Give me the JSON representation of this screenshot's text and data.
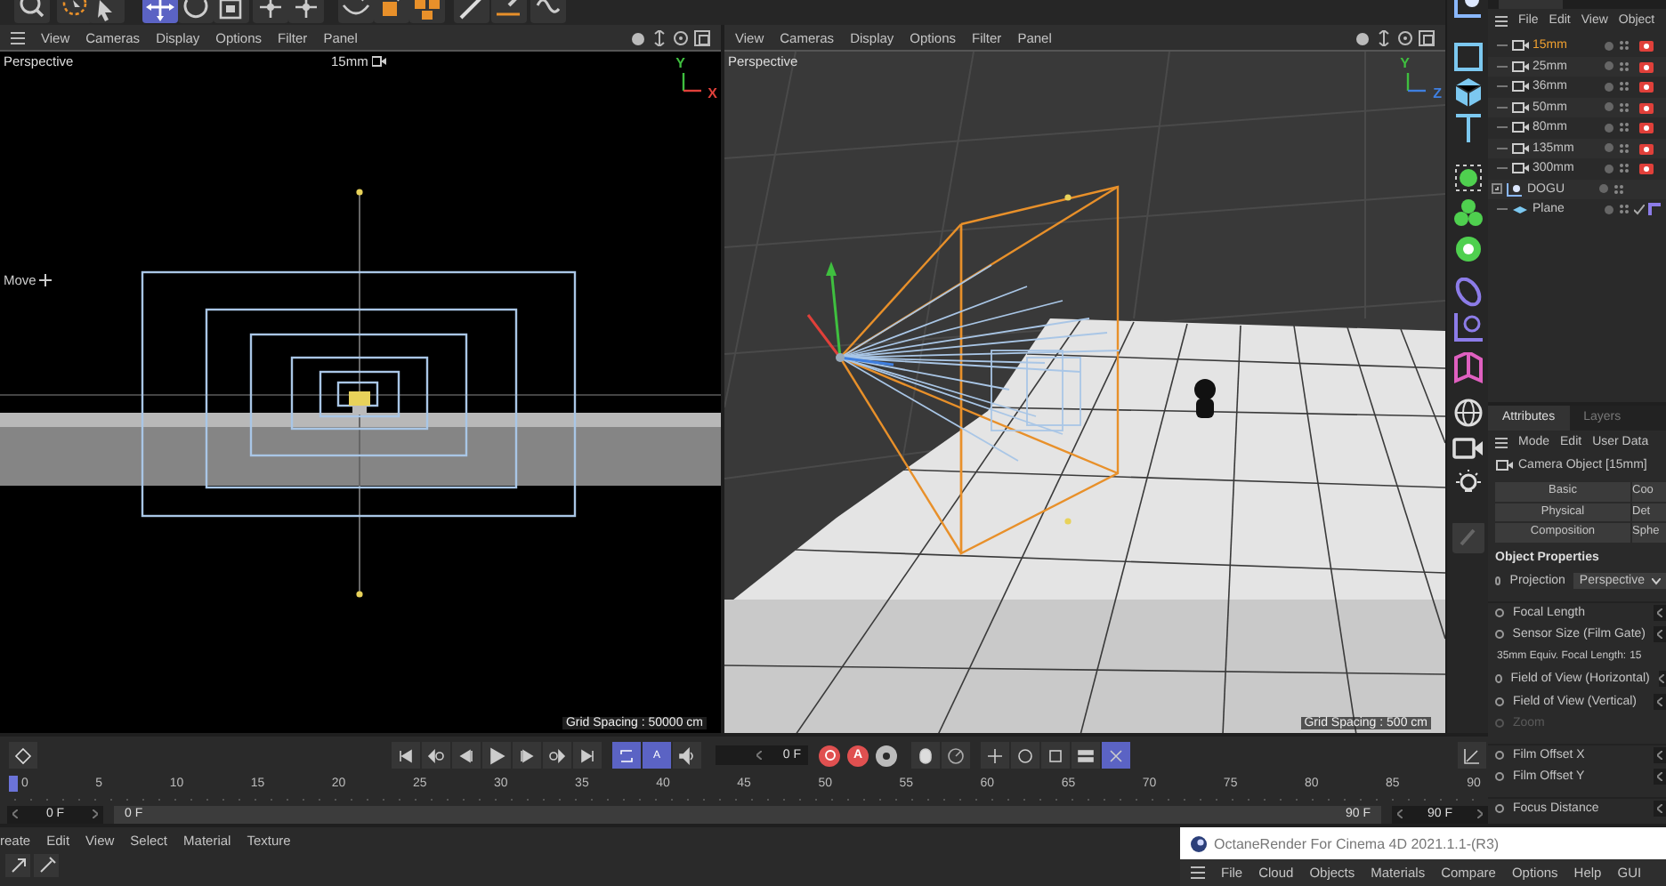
{
  "toolbar": {
    "tools": [
      {
        "kind": "search",
        "selected": false
      },
      {
        "kind": "live_select",
        "selected": false
      },
      {
        "kind": "cursor",
        "selected": false
      },
      {
        "kind": "move",
        "selected": true
      },
      {
        "kind": "rotate",
        "selected": false
      },
      {
        "kind": "scale",
        "selected": false
      },
      {
        "kind": "axis",
        "selected": false
      },
      {
        "kind": "axis",
        "selected": false
      },
      {
        "kind": "spline",
        "selected": false
      },
      {
        "kind": "cube",
        "selected": false
      },
      {
        "kind": "cubes",
        "selected": false
      },
      {
        "kind": "brush",
        "selected": false
      },
      {
        "kind": "line",
        "selected": false
      },
      {
        "kind": "curve",
        "selected": false
      }
    ]
  },
  "viewports": [
    {
      "kind": "front",
      "menu": [
        "View",
        "Cameras",
        "Display",
        "Options",
        "Filter",
        "Panel"
      ],
      "label": "Perspective",
      "camera": "15mm",
      "mode": "Move",
      "axes": [
        {
          "label": "Y",
          "color": "#3fbf3f"
        },
        {
          "label": "X",
          "color": "#e0403a"
        }
      ],
      "grid_spacing": "Grid Spacing : 50000 cm"
    },
    {
      "kind": "perspective",
      "menu": [
        "View",
        "Cameras",
        "Display",
        "Options",
        "Filter",
        "Panel"
      ],
      "label": "Perspective",
      "axes": [
        {
          "label": "Y",
          "color": "#3fbf3f"
        },
        {
          "label": "Z",
          "color": "#3f7fe0"
        }
      ],
      "grid_spacing": "Grid Spacing : 500 cm"
    }
  ],
  "object_manager": {
    "menu": [
      "File",
      "Edit",
      "View",
      "Object"
    ],
    "objects": [
      {
        "kind": "camera",
        "name": "15mm",
        "selected": true
      },
      {
        "kind": "camera",
        "name": "25mm",
        "selected": false
      },
      {
        "kind": "camera",
        "name": "36mm",
        "selected": false
      },
      {
        "kind": "camera",
        "name": "50mm",
        "selected": false
      },
      {
        "kind": "camera",
        "name": "80mm",
        "selected": false
      },
      {
        "kind": "camera",
        "name": "135mm",
        "selected": false
      },
      {
        "kind": "camera",
        "name": "300mm",
        "selected": false
      },
      {
        "kind": "null",
        "name": "DOGU",
        "selected": false,
        "expanded": false
      },
      {
        "kind": "plane",
        "name": "Plane",
        "selected": false
      }
    ]
  },
  "attributes": {
    "tabs": [
      {
        "label": "Attributes",
        "selected": true
      },
      {
        "label": "Layers",
        "selected": false
      }
    ],
    "menu": [
      "Mode",
      "Edit",
      "User Data"
    ],
    "object_title": "Camera Object [15mm]",
    "property_tabs": [
      "Basic",
      "Coo",
      "Physical",
      "Det",
      "Composition",
      "Sphe"
    ],
    "section": "Object Properties",
    "properties": [
      {
        "kind": "dropdown",
        "label": "Projection",
        "value": "Perspective"
      },
      {
        "kind": "field",
        "label": "Focal Length",
        "disabled": false
      },
      {
        "kind": "field",
        "label": "Sensor Size (Film Gate)",
        "disabled": false
      },
      {
        "kind": "info",
        "label": "35mm Equiv. Focal Length:",
        "value": "15"
      },
      {
        "kind": "field",
        "label": "Field of View (Horizontal)",
        "disabled": false
      },
      {
        "kind": "field",
        "label": "Field of View (Vertical)",
        "disabled": false
      },
      {
        "kind": "field",
        "label": "Zoom",
        "disabled": true
      },
      {
        "kind": "field",
        "label": "Film Offset X",
        "disabled": false
      },
      {
        "kind": "field",
        "label": "Film Offset Y",
        "disabled": false
      },
      {
        "kind": "field",
        "label": "Focus Distance",
        "disabled": false
      }
    ]
  },
  "timeline": {
    "current_frame": "0 F",
    "autokey_label": "A",
    "record_label": "A",
    "ruler": [
      "0",
      "5",
      "10",
      "15",
      "20",
      "25",
      "30",
      "35",
      "40",
      "45",
      "50",
      "55",
      "60",
      "65",
      "70",
      "75",
      "80",
      "85",
      "90"
    ],
    "start": "0 F",
    "range_start": "0 F",
    "range_end": "90 F",
    "end": "90 F"
  },
  "material_manager": {
    "menu": [
      "reate",
      "Edit",
      "View",
      "Select",
      "Material",
      "Texture"
    ]
  },
  "octane": {
    "title": "OctaneRender For Cinema 4D 2021.1.1-(R3)",
    "menu": [
      "File",
      "Cloud",
      "Objects",
      "Materials",
      "Compare",
      "Options",
      "Help",
      "GUI"
    ]
  }
}
